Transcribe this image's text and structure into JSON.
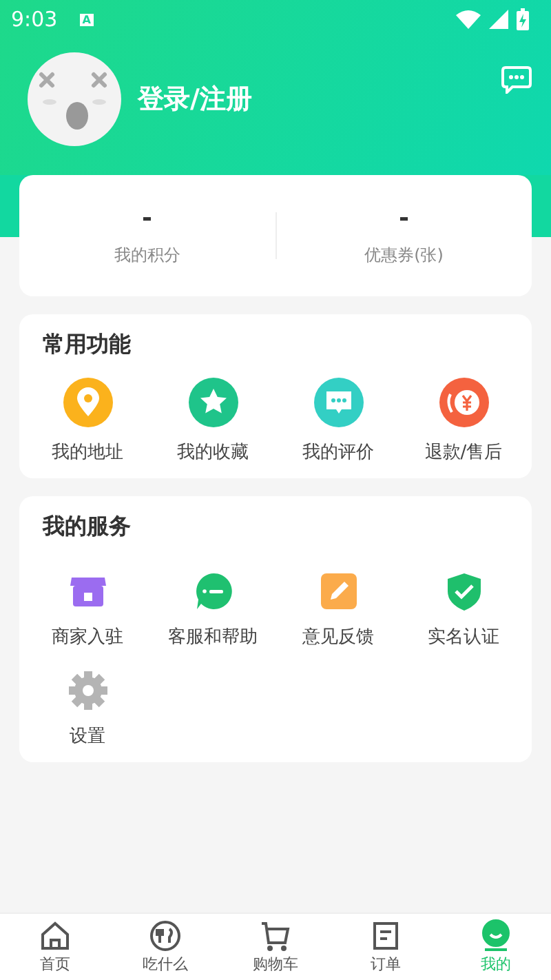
{
  "status_bar": {
    "time": "9:03",
    "notification": "A"
  },
  "profile": {
    "login_text": "登录/注册"
  },
  "stats": [
    {
      "value": "-",
      "label": "我的积分"
    },
    {
      "value": "-",
      "label": "优惠券(张)"
    }
  ],
  "common_functions": {
    "title": "常用功能",
    "items": [
      {
        "kind": "pin",
        "label": "我的地址",
        "color": "#fbb21c"
      },
      {
        "kind": "star",
        "label": "我的收藏",
        "color": "#1fc48a"
      },
      {
        "kind": "chat",
        "label": "我的评价",
        "color": "#33cfc4"
      },
      {
        "kind": "refund",
        "label": "退款/售后",
        "color": "#f4623f"
      }
    ]
  },
  "my_services": {
    "title": "我的服务",
    "items": [
      {
        "kind": "store",
        "label": "商家入驻",
        "color": "#9b6cf0"
      },
      {
        "kind": "support",
        "label": "客服和帮助",
        "color": "#1fc070"
      },
      {
        "kind": "edit",
        "label": "意见反馈",
        "color": "#fbab4b"
      },
      {
        "kind": "shield",
        "label": "实名认证",
        "color": "#1fbf6c"
      },
      {
        "kind": "gear",
        "label": "设置",
        "color": "#b4b4b4"
      }
    ]
  },
  "tab_bar": [
    {
      "kind": "home",
      "label": "首页",
      "selected": false
    },
    {
      "kind": "food",
      "label": "吃什么",
      "selected": false
    },
    {
      "kind": "cart",
      "label": "购物车",
      "selected": false
    },
    {
      "kind": "order",
      "label": "订单",
      "selected": false
    },
    {
      "kind": "me",
      "label": "我的",
      "selected": true
    }
  ]
}
